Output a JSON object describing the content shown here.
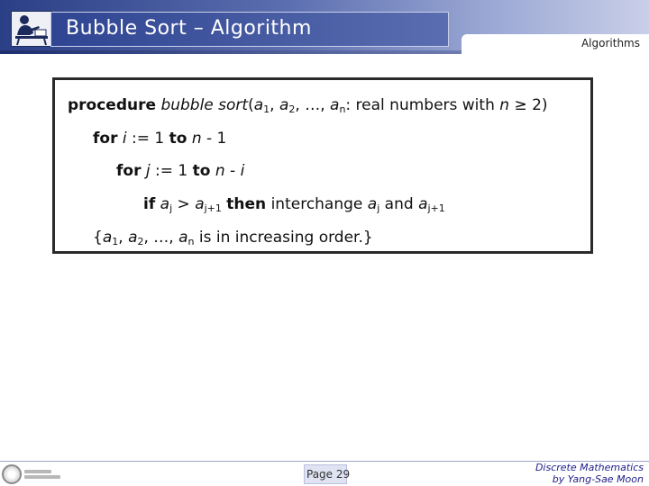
{
  "header": {
    "title": "Bubble Sort – Algorithm",
    "section_tab": "Algorithms"
  },
  "algorithm": {
    "line1": {
      "kw_procedure": "procedure",
      "name": "bubble sort",
      "open": "(",
      "a1_var": "a",
      "a1_sub": "1",
      "sep1": ", ",
      "a2_var": "a",
      "a2_sub": "2",
      "sep2": ", …, ",
      "an_var": "a",
      "an_sub": "n",
      "rest": ": real numbers with ",
      "n_var": "n",
      "cond": " ≥ 2)"
    },
    "line2": {
      "kw_for": "for",
      "i_var": "i",
      "mid": " := 1 ",
      "kw_to": "to",
      "n_var": "n",
      "end": " - 1"
    },
    "line3": {
      "kw_for": "for",
      "j_var": "j",
      "mid": " := 1 ",
      "kw_to": "to",
      "n_var": "n",
      "minus": " - ",
      "i_var": "i"
    },
    "line4": {
      "kw_if": "if",
      "aj_var": "a",
      "aj_sub": "j",
      "gt": " > ",
      "aj1_var": "a",
      "aj1_sub": "j+1",
      "kw_then": "then",
      "action": " interchange ",
      "aj2_var": "a",
      "aj2_sub": "j",
      "and": " and ",
      "aj3_var": "a",
      "aj3_sub": "j+1"
    },
    "line5": {
      "open": "{",
      "a1_var": "a",
      "a1_sub": "1",
      "sep1": ", ",
      "a2_var": "a",
      "a2_sub": "2",
      "sep2": ", …, ",
      "an_var": "a",
      "an_sub": "n",
      "rest": " is in increasing order.}"
    }
  },
  "footer": {
    "page": "Page 29",
    "credit_line1": "Discrete Mathematics",
    "credit_line2": "by Yang-Sae Moon"
  },
  "colors": {
    "header_dark": "#2b3f86",
    "header_light": "#c9cfe8",
    "credit_text": "#1d1d8a"
  }
}
